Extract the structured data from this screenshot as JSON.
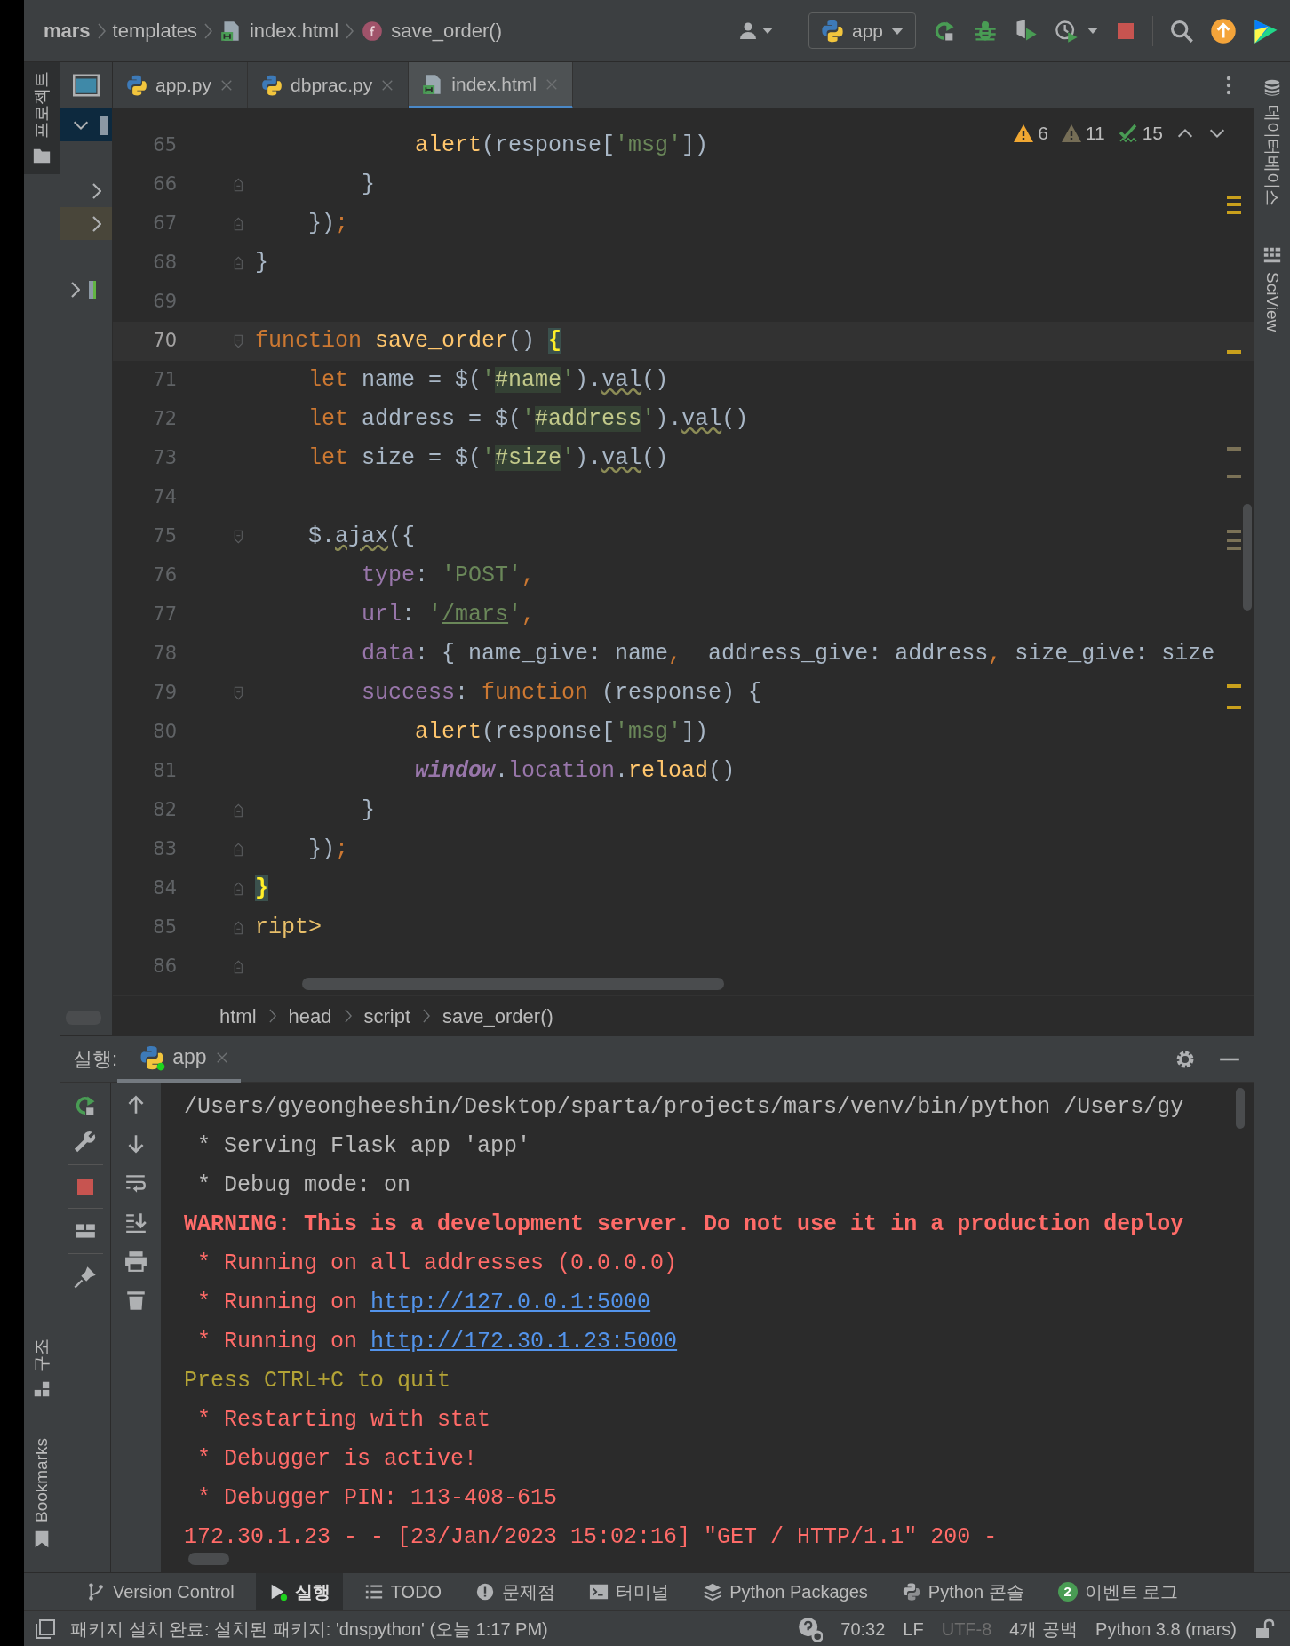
{
  "breadcrumbs": [
    {
      "label": "mars",
      "kind": "project"
    },
    {
      "label": "templates",
      "kind": "folder"
    },
    {
      "label": "index.html",
      "kind": "html"
    },
    {
      "label": "save_order()",
      "kind": "function"
    }
  ],
  "run_config": {
    "label": "app"
  },
  "tabs": [
    {
      "label": "app.py",
      "kind": "python",
      "selected": false
    },
    {
      "label": "dbprac.py",
      "kind": "python",
      "selected": false
    },
    {
      "label": "index.html",
      "kind": "html",
      "selected": true
    }
  ],
  "left_strip": {
    "top": [
      {
        "label": "프로젝트",
        "kind": "folder"
      }
    ],
    "bottom": [
      {
        "label": "구조",
        "kind": "structure"
      },
      {
        "label": "Bookmarks",
        "kind": "bookmark"
      }
    ]
  },
  "right_strip": [
    {
      "label": "데이터베이스",
      "kind": "database"
    },
    {
      "label": "SciView",
      "kind": "grid"
    }
  ],
  "inspections": [
    {
      "count": "6",
      "kind": "warning"
    },
    {
      "count": "11",
      "kind": "weak_warning"
    },
    {
      "count": "15",
      "kind": "typo"
    }
  ],
  "editor": {
    "lines": [
      {
        "number": "65",
        "current": false,
        "kind": "plain",
        "tokens": [
          {
            "t": "            alert",
            "kind": "function"
          },
          {
            "t": "(response[",
            "kind": "plain"
          },
          {
            "t": "'msg'",
            "kind": "string"
          },
          {
            "t": "])",
            "kind": "plain"
          }
        ]
      },
      {
        "number": "66",
        "current": false,
        "kind": "fold_end",
        "tokens": [
          {
            "t": "        }",
            "kind": "plain"
          }
        ]
      },
      {
        "number": "67",
        "current": false,
        "kind": "fold_end",
        "tokens": [
          {
            "t": "    })",
            "kind": "plain"
          },
          {
            "t": ";",
            "kind": "punctuation"
          }
        ]
      },
      {
        "number": "68",
        "current": false,
        "kind": "fold_end",
        "tokens": [
          {
            "t": "}",
            "kind": "plain"
          }
        ]
      },
      {
        "number": "69",
        "current": false,
        "kind": "plain"
      },
      {
        "number": "70",
        "current": true,
        "kind": "fold_start",
        "tokens": [
          {
            "t": "function ",
            "kind": "keyword"
          },
          {
            "t": "save_order",
            "kind": "function"
          },
          {
            "t": "() ",
            "kind": "plain"
          },
          {
            "t": "{",
            "kind": "brace_match"
          }
        ]
      },
      {
        "number": "71",
        "current": false,
        "kind": "plain",
        "tokens": [
          {
            "t": "    let",
            "kind": "keyword"
          },
          {
            "t": " name = $(",
            "kind": "plain"
          },
          {
            "t": "'",
            "kind": "string"
          },
          {
            "t": "#name",
            "kind": "string",
            "highlight": true
          },
          {
            "t": "'",
            "kind": "string"
          },
          {
            "t": ").",
            "kind": "plain"
          },
          {
            "t": "val",
            "kind": "plain",
            "wavy": true
          },
          {
            "t": "()",
            "kind": "plain"
          }
        ]
      },
      {
        "number": "72",
        "current": false,
        "kind": "plain",
        "tokens": [
          {
            "t": "    let",
            "kind": "keyword"
          },
          {
            "t": " address = $(",
            "kind": "plain"
          },
          {
            "t": "'",
            "kind": "string"
          },
          {
            "t": "#address",
            "kind": "string",
            "highlight": true
          },
          {
            "t": "'",
            "kind": "string"
          },
          {
            "t": ").",
            "kind": "plain"
          },
          {
            "t": "val",
            "kind": "plain",
            "wavy": true
          },
          {
            "t": "()",
            "kind": "plain"
          }
        ]
      },
      {
        "number": "73",
        "current": false,
        "kind": "plain",
        "tokens": [
          {
            "t": "    let",
            "kind": "keyword"
          },
          {
            "t": " size = $(",
            "kind": "plain"
          },
          {
            "t": "'",
            "kind": "string"
          },
          {
            "t": "#size",
            "kind": "string",
            "highlight": true
          },
          {
            "t": "'",
            "kind": "string"
          },
          {
            "t": ").",
            "kind": "plain"
          },
          {
            "t": "val",
            "kind": "plain",
            "wavy": true
          },
          {
            "t": "()",
            "kind": "plain"
          }
        ]
      },
      {
        "number": "74",
        "current": false,
        "kind": "plain"
      },
      {
        "number": "75",
        "current": false,
        "kind": "fold_start",
        "tokens": [
          {
            "t": "    $.",
            "kind": "plain"
          },
          {
            "t": "ajax",
            "kind": "plain",
            "wavy": true
          },
          {
            "t": "({",
            "kind": "plain"
          }
        ]
      },
      {
        "number": "76",
        "current": false,
        "kind": "plain",
        "tokens": [
          {
            "t": "        type",
            "kind": "property"
          },
          {
            "t": ": ",
            "kind": "plain"
          },
          {
            "t": "'POST'",
            "kind": "string"
          },
          {
            "t": ",",
            "kind": "punctuation"
          }
        ]
      },
      {
        "number": "77",
        "current": false,
        "kind": "plain",
        "tokens": [
          {
            "t": "        url",
            "kind": "property"
          },
          {
            "t": ": ",
            "kind": "plain"
          },
          {
            "t": "'",
            "kind": "string"
          },
          {
            "t": "/mars",
            "kind": "string",
            "link": true
          },
          {
            "t": "'",
            "kind": "string"
          },
          {
            "t": ",",
            "kind": "punctuation"
          }
        ]
      },
      {
        "number": "78",
        "current": false,
        "kind": "plain",
        "tokens": [
          {
            "t": "        data",
            "kind": "property"
          },
          {
            "t": ": { name_give: name",
            "kind": "plain"
          },
          {
            "t": ",",
            "kind": "punctuation"
          },
          {
            "t": "  address_give: address",
            "kind": "plain"
          },
          {
            "t": ",",
            "kind": "punctuation"
          },
          {
            "t": " size_give: size",
            "kind": "plain"
          }
        ]
      },
      {
        "number": "79",
        "current": false,
        "kind": "fold_start",
        "tokens": [
          {
            "t": "        success",
            "kind": "property"
          },
          {
            "t": ": ",
            "kind": "plain"
          },
          {
            "t": "function",
            "kind": "keyword"
          },
          {
            "t": " (response) {",
            "kind": "plain"
          }
        ]
      },
      {
        "number": "80",
        "current": false,
        "kind": "plain",
        "tokens": [
          {
            "t": "            alert",
            "kind": "function"
          },
          {
            "t": "(response[",
            "kind": "plain"
          },
          {
            "t": "'msg'",
            "kind": "string"
          },
          {
            "t": "])",
            "kind": "plain"
          }
        ]
      },
      {
        "number": "81",
        "current": false,
        "kind": "plain",
        "tokens": [
          {
            "t": "            window",
            "kind": "global"
          },
          {
            "t": ".",
            "kind": "plain"
          },
          {
            "t": "location",
            "kind": "property"
          },
          {
            "t": ".",
            "kind": "plain"
          },
          {
            "t": "reload",
            "kind": "function"
          },
          {
            "t": "()",
            "kind": "plain"
          }
        ]
      },
      {
        "number": "82",
        "current": false,
        "kind": "fold_end",
        "tokens": [
          {
            "t": "        }",
            "kind": "plain"
          }
        ]
      },
      {
        "number": "83",
        "current": false,
        "kind": "fold_end",
        "tokens": [
          {
            "t": "    })",
            "kind": "plain"
          },
          {
            "t": ";",
            "kind": "punctuation"
          }
        ]
      },
      {
        "number": "84",
        "current": false,
        "kind": "fold_end",
        "tokens": [
          {
            "t": "}",
            "kind": "brace_match"
          }
        ]
      },
      {
        "number": "85",
        "current": false,
        "kind": "fold_end",
        "tokens": [
          {
            "t": "ript>",
            "kind": "tag"
          }
        ]
      },
      {
        "number": "86",
        "current": false,
        "kind": "fold_end"
      }
    ]
  },
  "code_breadcrumbs": [
    "html",
    "head",
    "script",
    "save_order()"
  ],
  "run_panel": {
    "label": "실행:",
    "tabs": [
      {
        "label": "app",
        "selected": true
      }
    ],
    "console": [
      {
        "parts": [
          {
            "text": "/Users/gyeongheeshin/Desktop/sparta/projects/mars/venv/bin/python /Users/gy",
            "kind": "normal"
          }
        ]
      },
      {
        "parts": [
          {
            "text": " * Serving Flask app 'app'",
            "kind": "normal"
          }
        ]
      },
      {
        "parts": [
          {
            "text": " * Debug mode: on",
            "kind": "normal"
          }
        ]
      },
      {
        "parts": [
          {
            "text": "WARNING: This is a development server. Do not use it in a production deploy",
            "kind": "error_bold"
          }
        ]
      },
      {
        "parts": [
          {
            "text": " * Running on all addresses (0.0.0.0)",
            "kind": "error"
          }
        ]
      },
      {
        "parts": [
          {
            "text": " * Running on ",
            "kind": "error"
          },
          {
            "text": "http://127.0.0.1:5000",
            "kind": "link"
          }
        ]
      },
      {
        "parts": [
          {
            "text": " * Running on ",
            "kind": "error"
          },
          {
            "text": "http://172.30.1.23:5000",
            "kind": "link"
          }
        ]
      },
      {
        "parts": [
          {
            "text": "Press CTRL+C to quit",
            "kind": "info"
          }
        ]
      },
      {
        "parts": [
          {
            "text": " * Restarting with stat",
            "kind": "error"
          }
        ]
      },
      {
        "parts": [
          {
            "text": " * Debugger is active!",
            "kind": "error"
          }
        ]
      },
      {
        "parts": [
          {
            "text": " * Debugger PIN: 113-408-615",
            "kind": "error"
          }
        ]
      },
      {
        "parts": [
          {
            "text": "172.30.1.23 - - [23/Jan/2023 15:02:16] \"GET / HTTP/1.1\" 200 -",
            "kind": "error"
          }
        ]
      }
    ]
  },
  "tool_windows": [
    {
      "label": "Version Control",
      "kind": "vcs",
      "selected": false
    },
    {
      "label": "실행",
      "kind": "run",
      "selected": true
    },
    {
      "label": "TODO",
      "kind": "todo",
      "selected": false
    },
    {
      "label": "문제점",
      "kind": "problems",
      "selected": false
    },
    {
      "label": "터미널",
      "kind": "terminal",
      "selected": false
    },
    {
      "label": "Python Packages",
      "kind": "packages",
      "selected": false
    },
    {
      "label": "Python 콘솔",
      "kind": "python",
      "selected": false
    },
    {
      "label": "이벤트 로그",
      "kind": "events",
      "selected": false,
      "badge": "2"
    }
  ],
  "status_bar": {
    "message": "패키지 설치 완료: 설치된 패키지: 'dnspython' (오늘 1:17 PM)",
    "items": [
      {
        "text": "70:32",
        "disabled": false
      },
      {
        "text": "LF",
        "disabled": false
      },
      {
        "text": "UTF-8",
        "disabled": true
      },
      {
        "text": "4개 공백",
        "disabled": false
      },
      {
        "text": "Python 3.8 (mars)",
        "disabled": false
      }
    ]
  }
}
